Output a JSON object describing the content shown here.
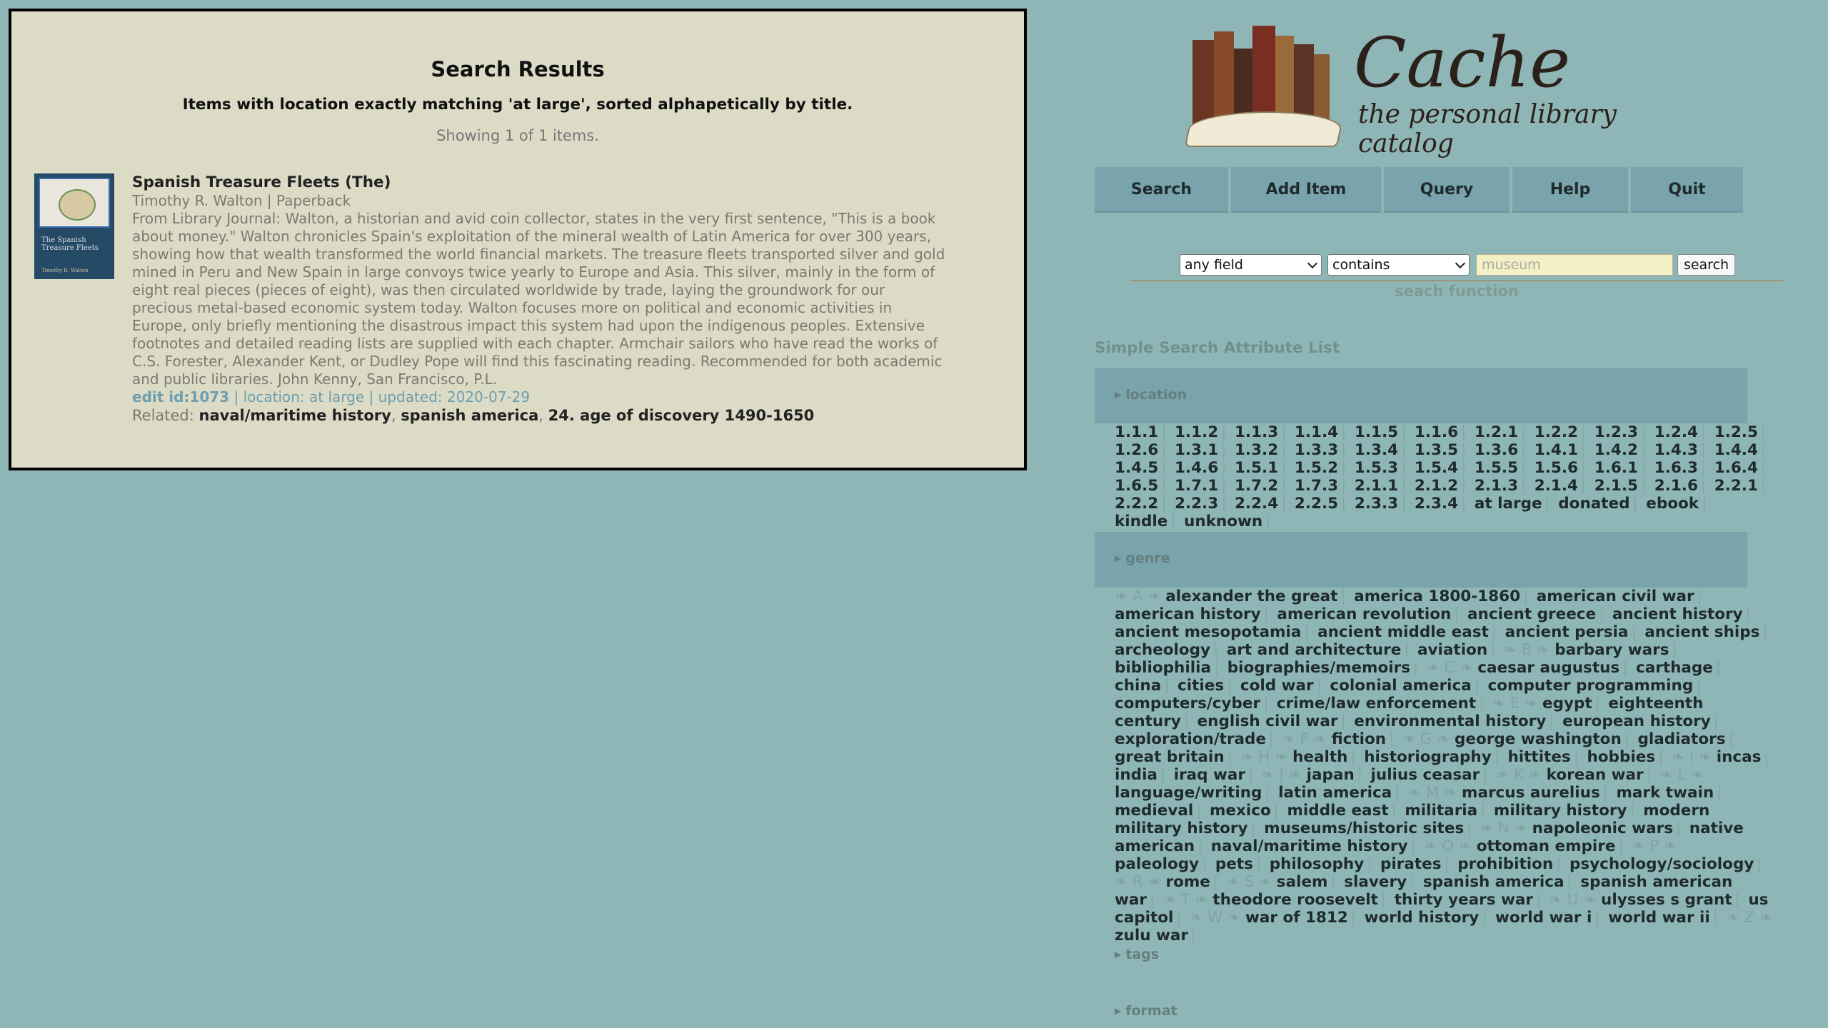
{
  "results": {
    "title": "Search Results",
    "subtitle": "Items with location exactly matching 'at large', sorted alphapetically by title.",
    "count": "Showing 1 of 1 items.",
    "item": {
      "cover_title": "The Spanish Treasure Fleets",
      "cover_author": "Timothy R. Walton",
      "title": "Spanish Treasure Fleets (The)",
      "meta": "Timothy R. Walton | Paperback",
      "description": "From Library Journal: Walton, a historian and avid coin collector, states in the very first sentence, \"This is a book about money.\" Walton chronicles Spain's exploitation of the mineral wealth of Latin America for over 300 years, showing how that wealth transformed the world financial markets. The treasure fleets transported silver and gold mined in Peru and New Spain in large convoys twice yearly to Europe and Asia. This silver, mainly in the form of eight real pieces (pieces of eight), was then circulated worldwide by trade, laying the groundwork for our precious metal-based economic system today. Walton focuses more on political and economic activities in Europe, only briefly mentioning the disastrous impact this system had upon the indigenous peoples. Extensive footnotes and detailed reading lists are supplied with each chapter. Armchair sailors who have read the works of C.S. Forester, Alexander Kent, or Dudley Pope will find this fascinating reading. Recommended for both academic and public libraries. John Kenny, San Francisco, P.L.",
      "edit_link": "edit id:1073",
      "location_text": "location: at large",
      "updated_text": "updated: 2020-07-29",
      "related_label": "Related:",
      "related": [
        "naval/maritime history",
        "spanish america",
        "24. age of discovery 1490-1650"
      ]
    }
  },
  "logo": {
    "name": "Cache",
    "tagline": "the personal library catalog"
  },
  "nav": [
    "Search",
    "Add Item",
    "Query",
    "Help",
    "Quit"
  ],
  "search": {
    "field": "any field",
    "operator": "contains",
    "placeholder": "museum",
    "button": "search",
    "caption": "seach function"
  },
  "attributes": {
    "heading": "Simple Search Attribute List",
    "location_label": "location",
    "location": [
      "1.1.1",
      "1.1.2",
      "1.1.3",
      "1.1.4",
      "1.1.5",
      "1.1.6",
      "1.2.1",
      "1.2.2",
      "1.2.3",
      "1.2.4",
      "1.2.5",
      "1.2.6",
      "1.3.1",
      "1.3.2",
      "1.3.3",
      "1.3.4",
      "1.3.5",
      "1.3.6",
      "1.4.1",
      "1.4.2",
      "1.4.3",
      "1.4.4",
      "1.4.5",
      "1.4.6",
      "1.5.1",
      "1.5.2",
      "1.5.3",
      "1.5.4",
      "1.5.5",
      "1.5.6",
      "1.6.1",
      "1.6.3",
      "1.6.4",
      "1.6.5",
      "1.7.1",
      "1.7.2",
      "1.7.3",
      "2.1.1",
      "2.1.2",
      "2.1.3",
      "2.1.4",
      "2.1.5",
      "2.1.6",
      "2.2.1",
      "2.2.2",
      "2.2.3",
      "2.2.4",
      "2.2.5",
      "2.3.3",
      "2.3.4",
      "at large",
      "donated",
      "ebook",
      "kindle",
      "unknown"
    ],
    "genre_label": "genre",
    "genre": [
      {
        "letter": "A"
      },
      "alexander the great",
      "america 1800-1860",
      "american civil war",
      "american history",
      "american revolution",
      "ancient greece",
      "ancient history",
      "ancient mesopotamia",
      "ancient middle east",
      "ancient persia",
      "ancient ships",
      "archeology",
      "art and architecture",
      "aviation",
      {
        "letter": "B"
      },
      "barbary wars",
      "bibliophilia",
      "biographies/memoirs",
      {
        "letter": "C"
      },
      "caesar augustus",
      "carthage",
      "china",
      "cities",
      "cold war",
      "colonial america",
      "computer programming",
      "computers/cyber",
      "crime/law enforcement",
      {
        "letter": "E"
      },
      "egypt",
      "eighteenth century",
      "english civil war",
      "environmental history",
      "european history",
      "exploration/trade",
      {
        "letter": "F"
      },
      "fiction",
      {
        "letter": "G"
      },
      "george washington",
      "gladiators",
      "great britain",
      {
        "letter": "H"
      },
      "health",
      "historiography",
      "hittites",
      "hobbies",
      {
        "letter": "I"
      },
      "incas",
      "india",
      "iraq war",
      {
        "letter": "J"
      },
      "japan",
      "julius ceasar",
      {
        "letter": "K"
      },
      "korean war",
      {
        "letter": "L"
      },
      "language/writing",
      "latin america",
      {
        "letter": "M"
      },
      "marcus aurelius",
      "mark twain",
      "medieval",
      "mexico",
      "middle east",
      "militaria",
      "military history",
      "modern military history",
      "museums/historic sites",
      {
        "letter": "N"
      },
      "napoleonic wars",
      "native american",
      "naval/maritime history",
      {
        "letter": "O"
      },
      "ottoman empire",
      {
        "letter": "P"
      },
      "paleology",
      "pets",
      "philosophy",
      "pirates",
      "prohibition",
      "psychology/sociology",
      {
        "letter": "R"
      },
      "rome",
      {
        "letter": "S"
      },
      "salem",
      "slavery",
      "spanish america",
      "spanish american war",
      {
        "letter": "T"
      },
      "theodore roosevelt",
      "thirty years war",
      {
        "letter": "U"
      },
      "ulysses s grant",
      "us capitol",
      {
        "letter": "W"
      },
      "war of 1812",
      "world history",
      "world war i",
      "world war ii",
      {
        "letter": "Z"
      },
      "zulu war"
    ],
    "tags_label": "tags",
    "format_label": "format"
  },
  "colors": {
    "background": "#8fb6b7",
    "panel": "#dcdbc5",
    "nav": "#7aa4ab",
    "link": "#1f2a2d"
  }
}
